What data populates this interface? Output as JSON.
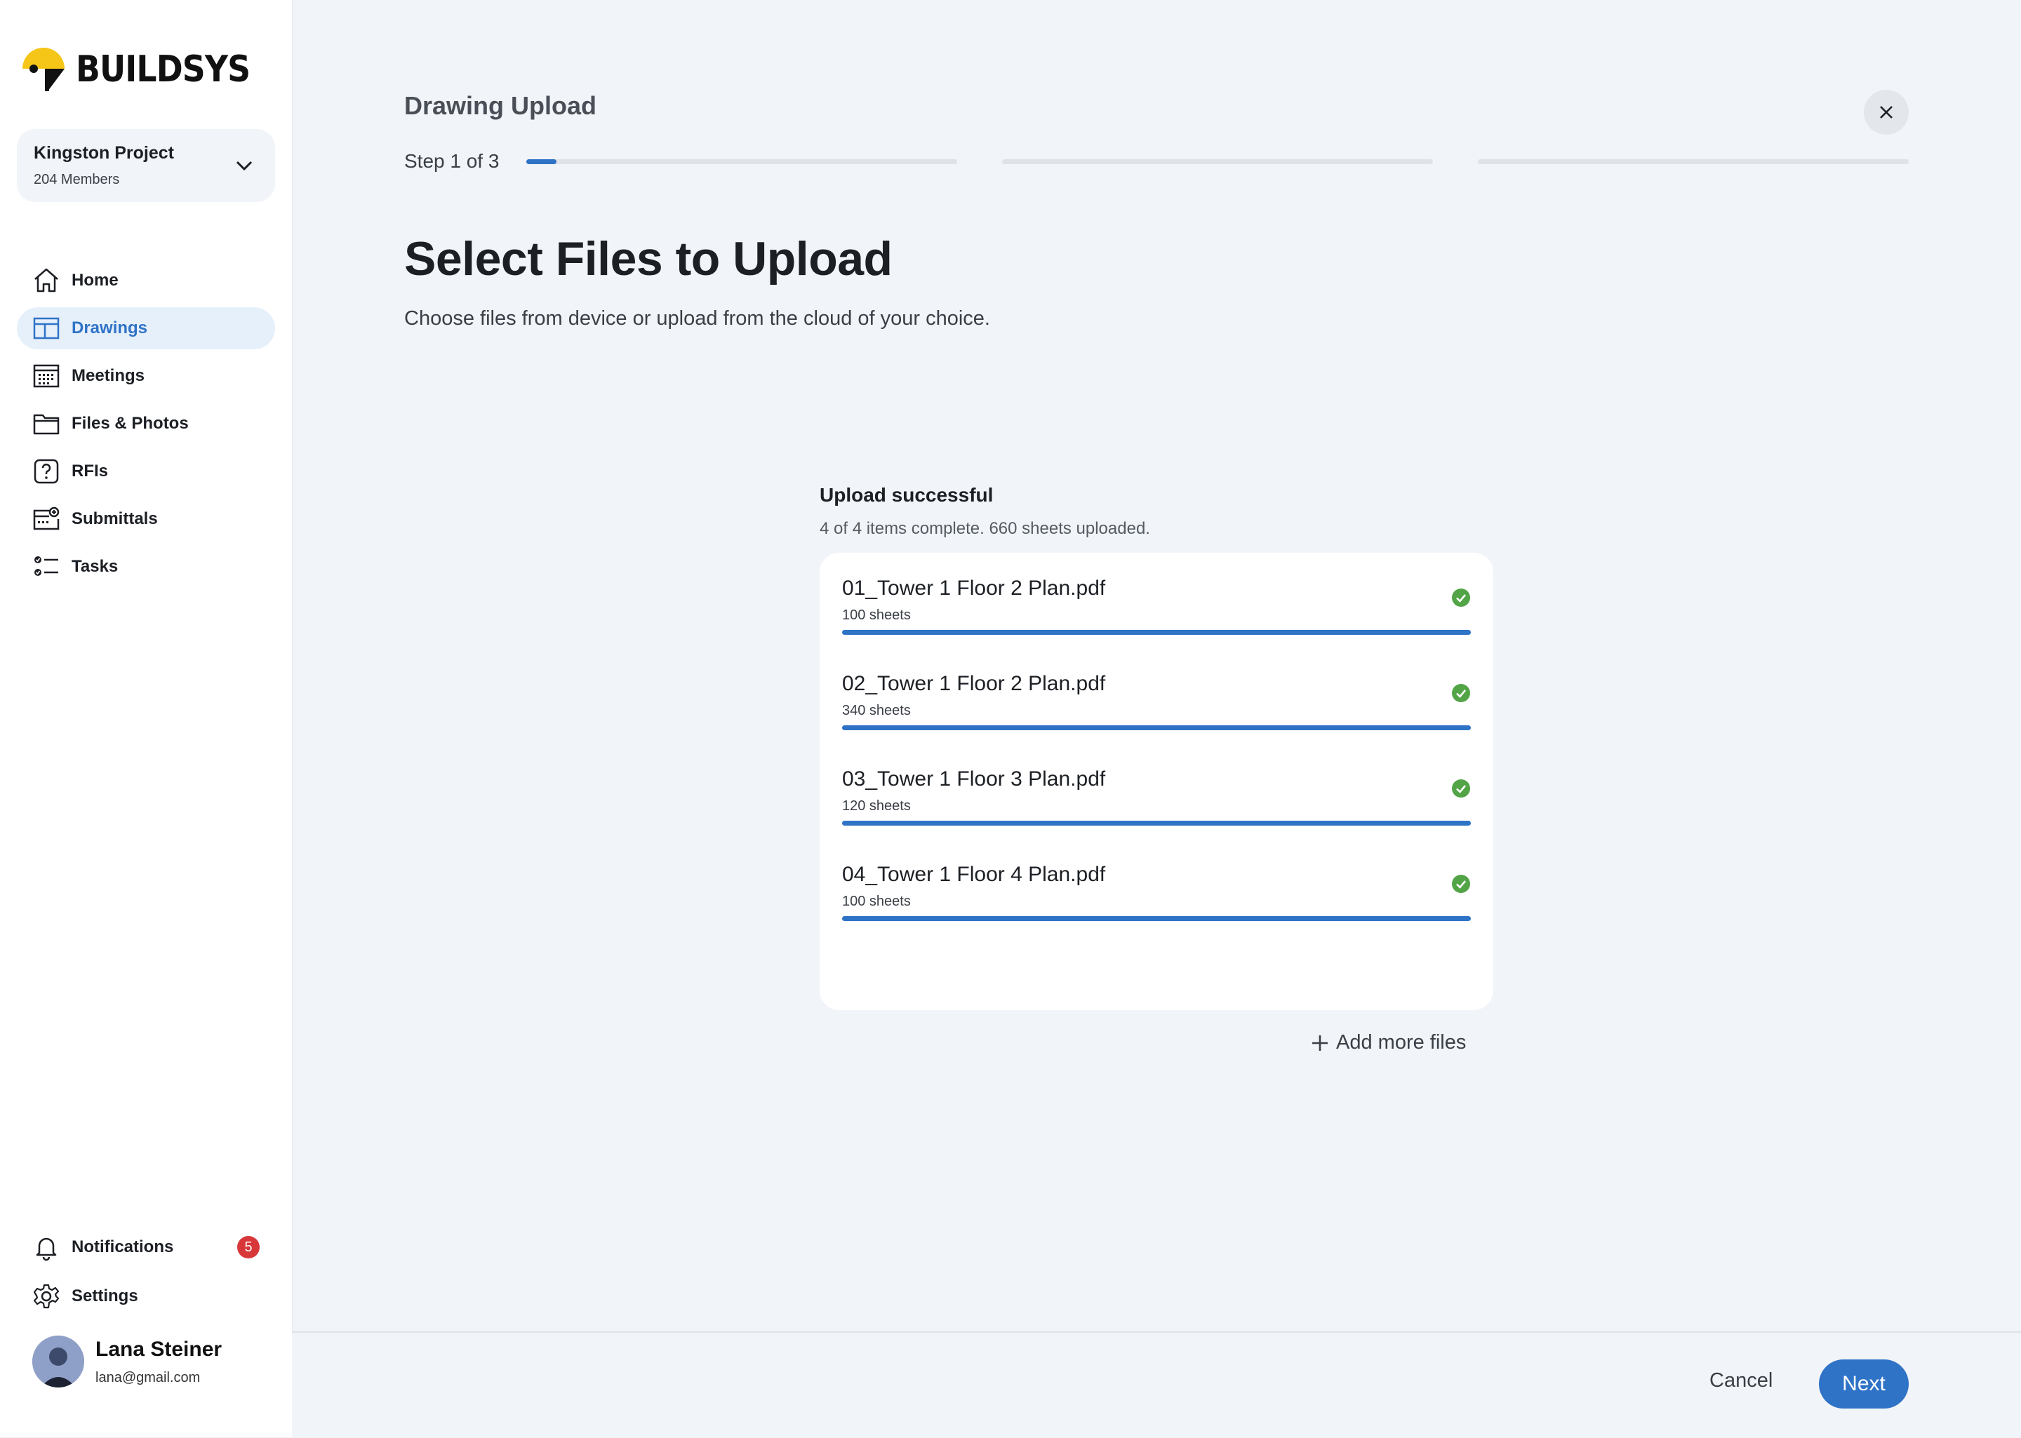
{
  "brand": {
    "name": "BUILDSYS",
    "accent": "#2f73c7",
    "logo_color": "#f5c518"
  },
  "project": {
    "name": "Kingston Project",
    "members": "204 Members"
  },
  "nav": {
    "items": [
      {
        "label": "Home",
        "icon": "home-icon",
        "active": false
      },
      {
        "label": "Drawings",
        "icon": "drawings-icon",
        "active": true
      },
      {
        "label": "Meetings",
        "icon": "calendar-icon",
        "active": false
      },
      {
        "label": "Files & Photos",
        "icon": "folder-icon",
        "active": false
      },
      {
        "label": "RFIs",
        "icon": "question-icon",
        "active": false
      },
      {
        "label": "Submittals",
        "icon": "submittals-icon",
        "active": false
      },
      {
        "label": "Tasks",
        "icon": "tasks-icon",
        "active": false
      }
    ],
    "notifications": {
      "label": "Notifications",
      "count": "5"
    },
    "settings": {
      "label": "Settings"
    }
  },
  "user": {
    "name": "Lana Steiner",
    "email": "lana@gmail.com"
  },
  "header": {
    "title": "Drawing Upload",
    "step_label": "Step 1 of 3",
    "step_progress": [
      0.07,
      0,
      0
    ]
  },
  "page": {
    "title": "Select Files to Upload",
    "subtitle": "Choose files from device or upload from the cloud of your choice."
  },
  "upload": {
    "status": "Upload successful",
    "summary": "4 of 4 items complete. 660 sheets uploaded.",
    "files": [
      {
        "name": "01_Tower 1 Floor 2 Plan.pdf",
        "sheets": "100 sheets",
        "progress": 1.0,
        "status_icon": "check-circle-icon"
      },
      {
        "name": "02_Tower 1 Floor 2 Plan.pdf",
        "sheets": "340 sheets",
        "progress": 1.0,
        "status_icon": "check-circle-icon"
      },
      {
        "name": "03_Tower 1 Floor 3 Plan.pdf",
        "sheets": "120 sheets",
        "progress": 1.0,
        "status_icon": "check-circle-icon"
      },
      {
        "name": "04_Tower 1 Floor 4 Plan.pdf",
        "sheets": "100 sheets",
        "progress": 1.0,
        "status_icon": "check-circle-icon"
      }
    ],
    "add_more_label": "Add more files"
  },
  "footer": {
    "cancel_label": "Cancel",
    "next_label": "Next"
  }
}
